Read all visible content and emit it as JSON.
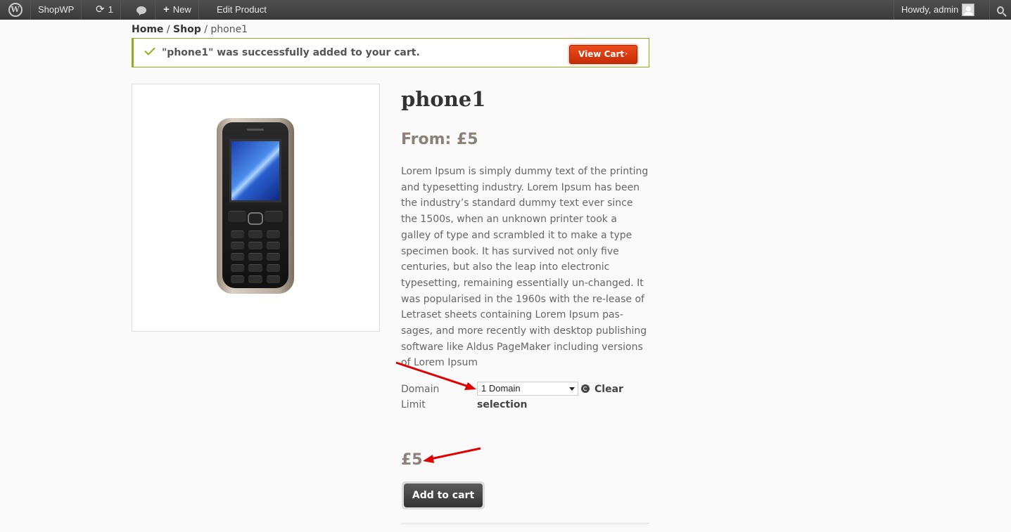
{
  "adminbar": {
    "site_name": "ShopWP",
    "updates_count": "1",
    "new_label": "New",
    "edit_label": "Edit Product",
    "howdy": "Howdy, admin"
  },
  "breadcrumb": {
    "home": "Home",
    "sep1": " / ",
    "shop": "Shop",
    "sep2": " / ",
    "current": "phone1"
  },
  "message": {
    "text": "\"phone1\" was successfully added to your cart.",
    "button": "View Cart",
    "button_arrow": "›"
  },
  "product": {
    "title": "phone1",
    "from_price": "From: £5",
    "description": "Lorem Ipsum is simply dummy text of the printing and typesetting industry. Lorem Ipsum has been the industry’s standard dummy text ever since the 1500s, when an unknown printer took a galley of type and scrambled it to make a type specimen book. It has survived not only five centuries, but also the leap into electronic typesetting, remaining essentially un-changed. It was popularised in the 1960s with the re-lease of Letraset sheets containing Lorem Ipsum pas-sages, and more recently with desktop publishing software like Aldus PageMaker including versions of Lorem Ipsum",
    "variation_label": "Domain Limit",
    "variation_selected": "1 Domain",
    "clear_label": "Clear selection",
    "price": "£5",
    "add_to_cart": "Add to cart"
  },
  "colors": {
    "accent_green": "#8fae1b",
    "view_cart_red": "#e2400f",
    "annotation_arrow": "#e00000"
  }
}
